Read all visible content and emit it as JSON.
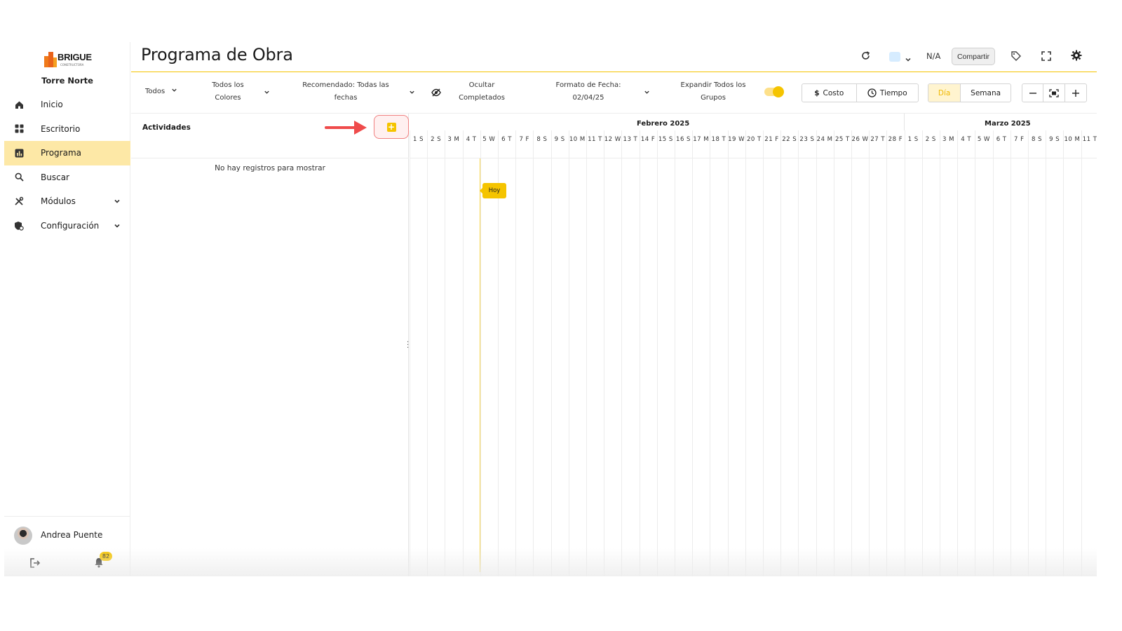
{
  "brand": {
    "name": "BRIGUE",
    "tagline": "CONSTRUCTORA"
  },
  "sidebar": {
    "project": "Torre Norte",
    "items": [
      {
        "label": "Inicio",
        "icon": "home-icon"
      },
      {
        "label": "Escritorio",
        "icon": "grid-icon"
      },
      {
        "label": "Programa",
        "icon": "chart-icon",
        "active": true
      },
      {
        "label": "Buscar",
        "icon": "search-icon"
      },
      {
        "label": "Módulos",
        "icon": "tools-icon",
        "expandable": true
      },
      {
        "label": "Configuración",
        "icon": "settings-shield-icon",
        "expandable": true
      }
    ],
    "user": {
      "name": "Andrea Puente",
      "notifications": "82"
    }
  },
  "header": {
    "title": "Programa de Obra",
    "na_label": "N/A",
    "share_label": "Compartir"
  },
  "toolbar": {
    "filter_all": "Todos",
    "colors_line1": "Todos los",
    "colors_line2": "Colores",
    "recommended_line1": "Recomendado: Todas las",
    "recommended_line2": "fechas",
    "hide_line1": "Ocultar",
    "hide_line2": "Completados",
    "date_format_line1": "Formato de Fecha:",
    "date_format_line2": "02/04/25",
    "expand_line1": "Expandir Todos los",
    "expand_line2": "Grupos",
    "expand_on": true,
    "cost_label": "Costo",
    "time_label": "Tiempo",
    "day_label": "Día",
    "week_label": "Semana"
  },
  "activities": {
    "header": "Actividades",
    "empty_message": "No hay registros para mostrar"
  },
  "gantt": {
    "months": [
      "Febrero 2025",
      "Marzo 2025"
    ],
    "days": [
      "1 S",
      "2 S",
      "3 M",
      "4 T",
      "5 W",
      "6 T",
      "7 F",
      "8 S",
      "9 S",
      "10 M",
      "11 T",
      "12 W",
      "13 T",
      "14 F",
      "15 S",
      "16 S",
      "17 M",
      "18 T",
      "19 W",
      "20 T",
      "21 F",
      "22 S",
      "23 S",
      "24 M",
      "25 T",
      "26 W",
      "27 T",
      "28 F",
      "1 S",
      "2 S",
      "3 M",
      "4 T",
      "5 W",
      "6 T",
      "7 F",
      "8 S",
      "9 S",
      "10 M",
      "11 T"
    ],
    "today_label": "Hoy"
  },
  "colors": {
    "accent": "#f5c400",
    "active_bg": "#fde8a6",
    "highlight_border": "#f08080"
  }
}
